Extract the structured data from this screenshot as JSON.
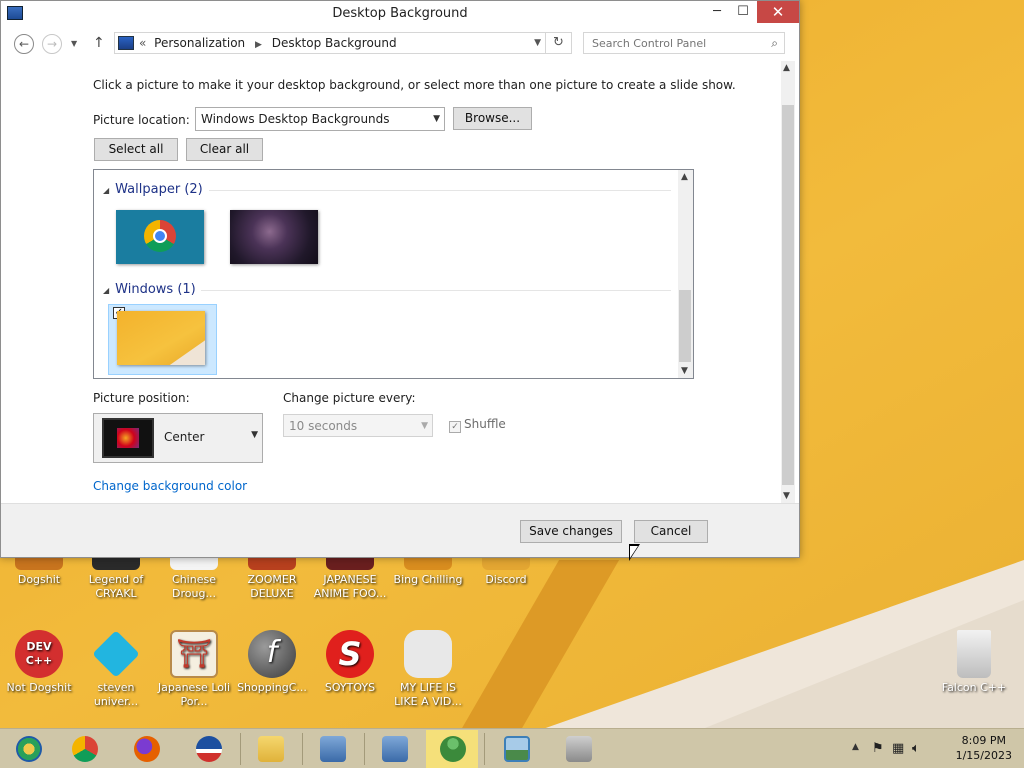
{
  "window": {
    "title": "Desktop Background",
    "minimize_glyph": "─",
    "maximize_glyph": "☐",
    "close_glyph": "✕"
  },
  "nav": {
    "breadcrumb_prefix": "«",
    "breadcrumb": [
      "Personalization",
      "Desktop Background"
    ],
    "search_placeholder": "Search Control Panel"
  },
  "content": {
    "intro": "Click a picture to make it your desktop background, or select more than one picture to create a slide show.",
    "picture_location_label": "Picture location:",
    "picture_location_value": "Windows Desktop Backgrounds",
    "browse_label": "Browse...",
    "select_all_label": "Select all",
    "clear_all_label": "Clear all",
    "groups": [
      {
        "label": "Wallpaper (2)"
      },
      {
        "label": "Windows (1)"
      }
    ],
    "picture_position_label": "Picture position:",
    "picture_position_value": "Center",
    "change_every_label": "Change picture every:",
    "change_every_value": "10 seconds",
    "shuffle_label": "Shuffle",
    "shuffle_checked": true,
    "background_color_link": "Change background color",
    "windows_wallpaper_checked": true
  },
  "footer": {
    "save_label": "Save changes",
    "cancel_label": "Cancel"
  },
  "desktop_icons": [
    {
      "label": "Dogshit",
      "icon": "dogshit-icon",
      "color": "#c8741e"
    },
    {
      "label": "Legend of CRYAKL",
      "icon": "game-icon",
      "color": "#2a2a2a"
    },
    {
      "label": "Chinese Droug...",
      "icon": "document-icon",
      "color": "#f4f4f4"
    },
    {
      "label": "ZOOMER DELUXE",
      "icon": "zoomer-icon",
      "color": "#b8401e"
    },
    {
      "label": "JAPANESE ANIME FOO...",
      "icon": "anime-icon",
      "color": "#6a1f1f"
    },
    {
      "label": "Bing Chilling",
      "icon": "bing-icon",
      "color": "#d98d1f"
    },
    {
      "label": "Discord",
      "icon": "discord-icon",
      "color": "#e3a632"
    },
    {
      "label": "Not Dogshit",
      "icon": "devcpp-icon",
      "color": "#d32f2f"
    },
    {
      "label": "steven univer...",
      "icon": "diamond-icon",
      "color": "#22b5e0"
    },
    {
      "label": "Japanese Loli Por...",
      "icon": "torii-icon",
      "color": "#f5efe0"
    },
    {
      "label": "ShoppingC...",
      "icon": "flash-icon",
      "color": "#5a5a5a"
    },
    {
      "label": "SOYTOYS",
      "icon": "soytoys-icon",
      "color": "#e0201d"
    },
    {
      "label": "MY LIFE IS LIKE A VID...",
      "icon": "gamepad-icon",
      "color": "#e8e8e8"
    },
    {
      "label": "Falcon C++",
      "icon": "recycle-bin-icon",
      "color": "#dcdcdc"
    }
  ],
  "taskbar": {
    "apps": [
      {
        "name": "start-icon",
        "color": "#2aa05a"
      },
      {
        "name": "chrome-icon",
        "color": "#4285f4"
      },
      {
        "name": "firefox-icon",
        "color": "#e66000"
      },
      {
        "name": "obama-icon",
        "color": "#1c4fa0"
      },
      {
        "name": "file-explorer-icon",
        "color": "#e8c34a"
      },
      {
        "name": "network-icon",
        "color": "#4a7ab5"
      },
      {
        "name": "network-icon",
        "color": "#4a7ab5"
      },
      {
        "name": "users-icon",
        "color": "#3b8a3b"
      },
      {
        "name": "photo-viewer-icon",
        "color": "#3d7fb8"
      },
      {
        "name": "tablet-icon",
        "color": "#888888"
      }
    ],
    "time": "8:09 PM",
    "date": "1/15/2023"
  }
}
